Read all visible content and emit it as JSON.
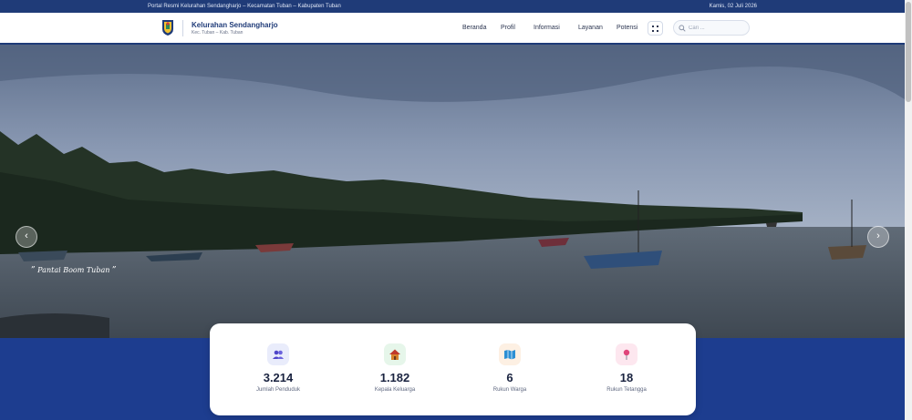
{
  "topbar": {
    "left_text": "Portal Resmi Kelurahan Sendangharjo – Kecamatan Tuban – Kabupaten Tuban",
    "date": "Kamis, 02 Juli 2026"
  },
  "header": {
    "title": "Kelurahan Sendangharjo",
    "subtitle": "Kec. Tuban – Kab. Tuban",
    "logo_icon": "regency-crest-icon"
  },
  "nav": {
    "items": [
      "Beranda",
      "Profil",
      "Informasi",
      "Layanan",
      "Potensi"
    ],
    "grid_icon": "grid-menu-icon"
  },
  "search": {
    "placeholder": "Cari ...",
    "value": "",
    "icon": "search-icon"
  },
  "hero": {
    "caption_open": "”",
    "caption": "Pantai Boom Tuban",
    "caption_close": "”",
    "prev_symbol": "‹",
    "next_symbol": "›"
  },
  "stats": [
    {
      "value": "3.214",
      "label": "Jumlah Penduduk",
      "icon": "people-icon",
      "bg": "#e9ecfb",
      "color": "#4f46c8"
    },
    {
      "value": "1.182",
      "label": "Kepala Keluarga",
      "icon": "house-icon",
      "bg": "#e6f6ea",
      "color": "#d9822b"
    },
    {
      "value": "6",
      "label": "Rukun Warga",
      "icon": "map-icon",
      "bg": "#fdf0e3",
      "color": "#2b8fd4"
    },
    {
      "value": "18",
      "label": "Rukun Tetangga",
      "icon": "pin-icon",
      "bg": "#fde7ef",
      "color": "#e0457b"
    }
  ],
  "colors": {
    "primary": "#1f3b78",
    "band": "#1d3d8f"
  }
}
